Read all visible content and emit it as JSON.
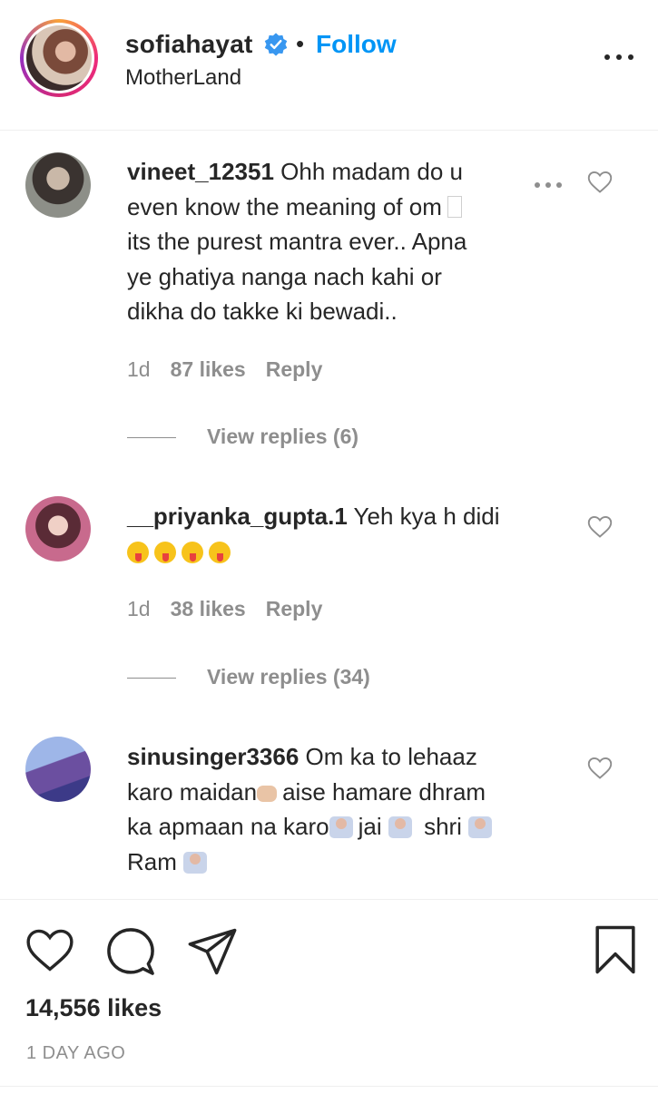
{
  "post_header": {
    "username": "sofiahayat",
    "separator": "•",
    "follow_label": "Follow",
    "location": "MotherLand",
    "verified_icon": "verified-badge-icon",
    "more_icon": "more-horizontal-icon"
  },
  "comments": [
    {
      "username": "vineet_12351",
      "text_lines": [
        " Ohh madam do u",
        "even know the meaning of om",
        "its the purest mantra ever.. Apna",
        "ye ghatiya nanga nach kahi or",
        "dikha do takke ki bewadi.."
      ],
      "time": "1d",
      "likes": "87 likes",
      "reply_label": "Reply",
      "view_replies": "View replies (6)"
    },
    {
      "username": "__priyanka_gupta.1",
      "text": " Yeh kya h didi",
      "emoji_line": [
        "tongue-emoji",
        "tongue-emoji",
        "tongue-emoji",
        "tongue-emoji"
      ],
      "time": "1d",
      "likes": "38 likes",
      "reply_label": "Reply",
      "view_replies": "View replies (34)"
    },
    {
      "username": "sinusinger3366",
      "line1": " Om ka to lehaaz",
      "line2_a": "karo maidan",
      "line2_b": "aise hamare dhram",
      "line3_a": "ka apmaan na karo",
      "line3_b": "jai ",
      "line3_c": " shri ",
      "line4": "Ram "
    }
  ],
  "actions": {
    "like_icon": "heart-icon",
    "comment_icon": "comment-icon",
    "share_icon": "paper-plane-icon",
    "save_icon": "bookmark-icon",
    "likes_total": "14,556 likes",
    "time_ago": "1 DAY AGO"
  },
  "colors": {
    "accent_blue": "#0095f6",
    "text_primary": "#262626",
    "text_secondary": "#8e8e8e",
    "divider": "#efefef"
  }
}
